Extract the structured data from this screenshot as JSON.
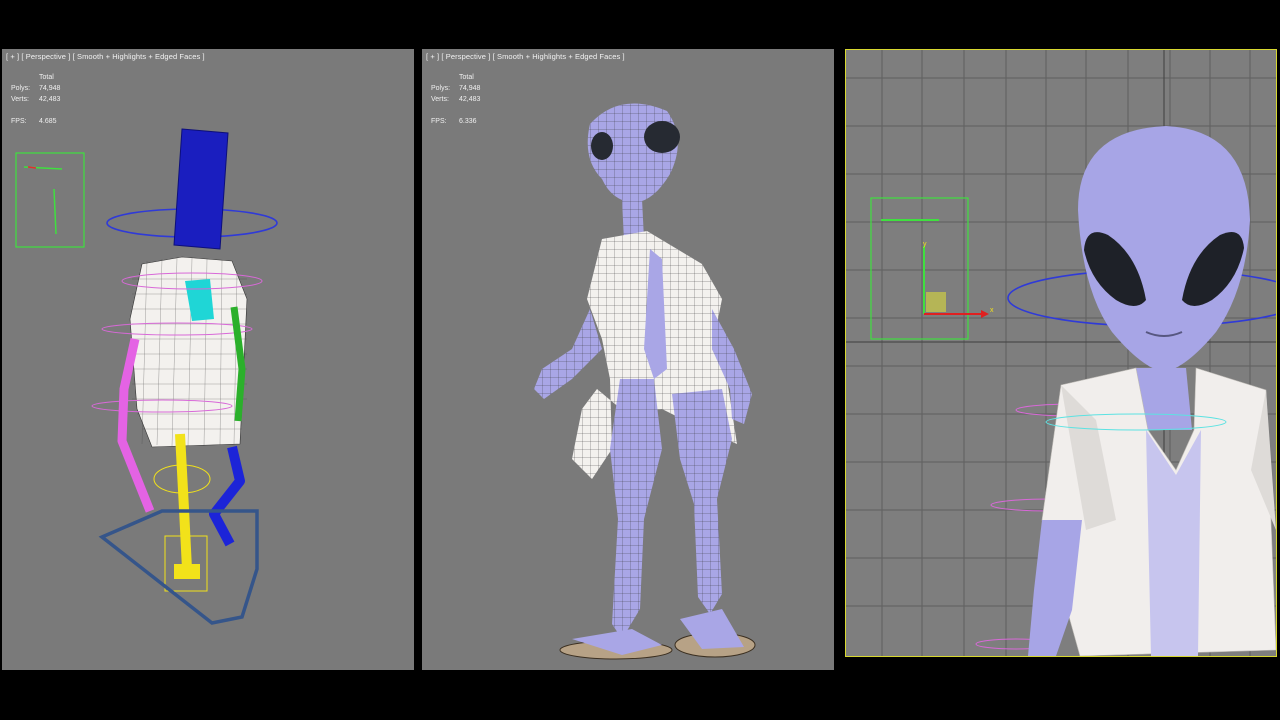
{
  "viewports": [
    {
      "label": "[ + ] [ Perspective ] [ Smooth + Highlights + Edged Faces ]",
      "stats": {
        "title": "Total",
        "polys_label": "Polys:",
        "polys": "74,948",
        "verts_label": "Verts:",
        "verts": "42,483",
        "fps_label": "FPS:",
        "fps": "4.685"
      }
    },
    {
      "label": "[ + ] [ Perspective ] [ Smooth + Highlights + Edged Faces ]",
      "stats": {
        "title": "Total",
        "polys_label": "Polys:",
        "polys": "74,948",
        "verts_label": "Verts:",
        "verts": "42,483",
        "fps_label": "FPS:",
        "fps": "6.336"
      }
    },
    {
      "gizmo_axis_x": "x",
      "gizmo_axis_y": "y"
    }
  ],
  "colors": {
    "viewport_bg": "#7a7a7a",
    "active_border": "#d8d830",
    "skin": "#a9a6e6",
    "shirt": "#f3f1ee",
    "bone_blue": "#1c24b8",
    "bone_cyan": "#1fd6d6",
    "bone_magenta": "#e463e4",
    "bone_yellow": "#f2e21a",
    "helper_green": "#3fe03f"
  }
}
